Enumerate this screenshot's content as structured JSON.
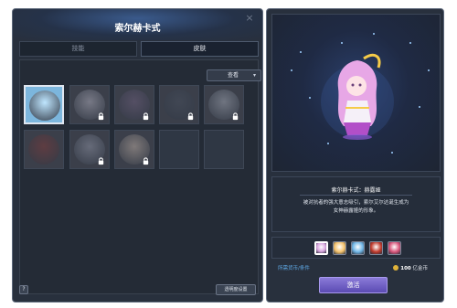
{
  "window": {
    "title": "索尔赫卡式",
    "close_glyph": "×"
  },
  "tabs": [
    {
      "label": "技能",
      "active": false
    },
    {
      "label": "皮肤",
      "active": true
    }
  ],
  "filter": {
    "label": "查看",
    "chevron": "▾"
  },
  "grid": {
    "slots": [
      {
        "state": "selected",
        "locked": false,
        "art_color": "#bfe6ff",
        "icon": "character-portrait-icon"
      },
      {
        "state": "filled",
        "locked": true,
        "art_color": "#a8a8b6",
        "icon": "character-portrait-icon"
      },
      {
        "state": "filled",
        "locked": true,
        "art_color": "#6a5d7a",
        "icon": "character-portrait-icon"
      },
      {
        "state": "filled",
        "locked": true,
        "art_color": "#464e5c",
        "icon": "character-portrait-icon"
      },
      {
        "state": "filled",
        "locked": true,
        "art_color": "#9aa0ad",
        "icon": "character-portrait-icon"
      },
      {
        "state": "filled",
        "locked": false,
        "art_color": "#7a3b3b",
        "icon": "character-portrait-icon"
      },
      {
        "state": "filled",
        "locked": true,
        "art_color": "#8a8fa0",
        "icon": "character-portrait-icon"
      },
      {
        "state": "filled",
        "locked": true,
        "art_color": "#b7a9a0",
        "icon": "character-portrait-icon"
      },
      {
        "state": "empty",
        "locked": false
      },
      {
        "state": "empty",
        "locked": false
      }
    ]
  },
  "footer": {
    "help_label": "?",
    "opacity_label": "透明度设置"
  },
  "preview": {
    "skin_name": "索尔赫卡式：赫露娅",
    "description_line1": "被对抗者的强大意志吸引，索尔艾尔达诞生成为",
    "description_line2": "女神赫露娅的形象。"
  },
  "color_options": [
    {
      "color": "#d9a6df",
      "selected": true
    },
    {
      "color": "#f3c16b",
      "selected": false
    },
    {
      "color": "#6fb5e6",
      "selected": false
    },
    {
      "color": "#c0392b",
      "selected": false
    },
    {
      "color": "#d8547a",
      "selected": false
    }
  ],
  "currency": {
    "label": "所需货币/条件",
    "amount": "100",
    "unit": "亿金币"
  },
  "activate_label": "激活",
  "colors": {
    "accent": "#5b4bb3",
    "panel": "#28303d",
    "link": "#5fa9e6"
  }
}
